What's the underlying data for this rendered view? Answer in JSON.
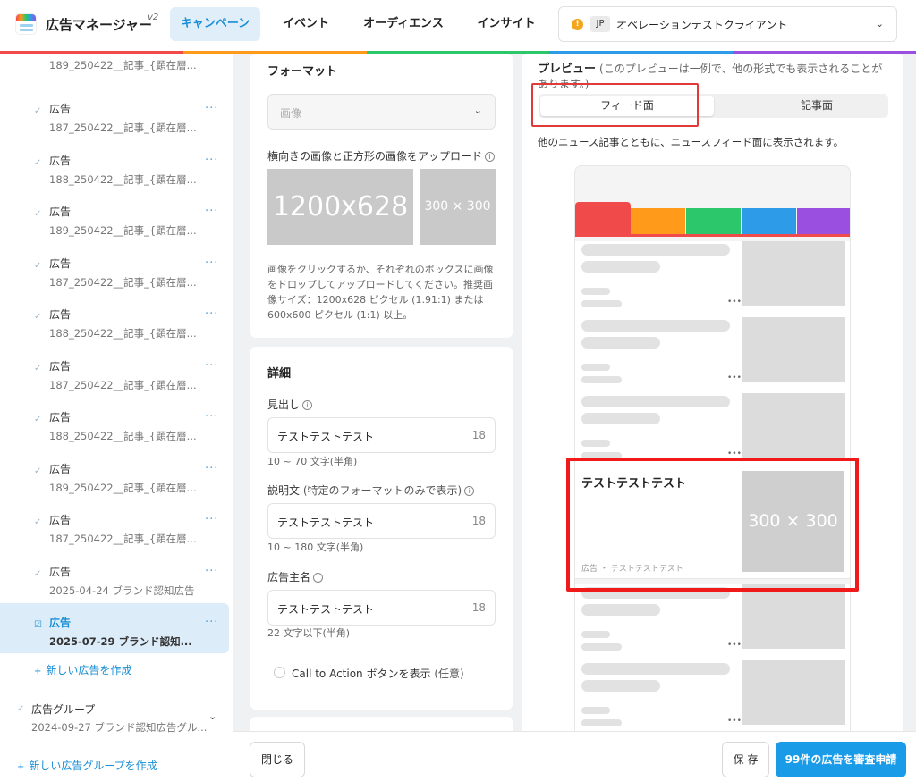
{
  "header": {
    "app_title": "広告マネージャー",
    "version": "v2",
    "tabs": [
      "キャンペーン",
      "イベント",
      "オーディエンス",
      "インサイト"
    ],
    "account_badge": "JP",
    "account_name": "オペレーションテストクライアント",
    "account_status_icon": "!"
  },
  "rainbow_colors": [
    "#f04a4a",
    "#ff9a1a",
    "#2cc66b",
    "#2d9be8",
    "#9b4fe0"
  ],
  "sidebar": {
    "partial_item_sub": "189_250422__記事_{顕在層...",
    "items": [
      {
        "title": "広告",
        "sub": "187_250422__記事_{顕在層..."
      },
      {
        "title": "広告",
        "sub": "188_250422__記事_{顕在層..."
      },
      {
        "title": "広告",
        "sub": "189_250422__記事_{顕在層..."
      },
      {
        "title": "広告",
        "sub": "187_250422__記事_{顕在層..."
      },
      {
        "title": "広告",
        "sub": "188_250422__記事_{顕在層..."
      },
      {
        "title": "広告",
        "sub": "187_250422__記事_{顕在層..."
      },
      {
        "title": "広告",
        "sub": "188_250422__記事_{顕在層..."
      },
      {
        "title": "広告",
        "sub": "189_250422__記事_{顕在層..."
      },
      {
        "title": "広告",
        "sub": "187_250422__記事_{顕在層..."
      },
      {
        "title": "広告",
        "sub": "2025-04-24 ブランド認知広告"
      },
      {
        "title": "広告",
        "sub": "2025-07-29 ブランド認知..."
      }
    ],
    "new_ad": "新しい広告を作成",
    "group": {
      "title": "広告グループ",
      "sub": "2024-09-27 ブランド認知広告グル..."
    },
    "new_group": "新しい広告グループを作成"
  },
  "format": {
    "title": "フォーマット",
    "select_value": "画像",
    "upload_label": "横向きの画像と正方形の画像をアップロード",
    "landscape": "1200x628",
    "square": "300 × 300",
    "help": "画像をクリックするか、それぞれのボックスに画像をドロップしてアップロードしてください。推奨画像サイズ：1200x628 ピクセル (1.91:1) または 600x600 ピクセル (1:1) 以上。"
  },
  "details": {
    "title": "詳細",
    "headline_label": "見出し",
    "headline_value": "テストテストテスト",
    "headline_count": "18",
    "headline_hint": "10 ~ 70 文字(半角)",
    "desc_label": "説明文",
    "desc_note": "(特定のフォーマットのみで表示)",
    "desc_value": "テストテストテスト",
    "desc_count": "18",
    "desc_hint": "10 ~ 180 文字(半角)",
    "advertiser_label": "広告主名",
    "advertiser_value": "テストテストテスト",
    "advertiser_count": "18",
    "advertiser_hint": "22 文字以下(半角)",
    "cta_label": "Call to Action ボタンを表示",
    "cta_note": "(任意)"
  },
  "preview": {
    "title": "プレビュー",
    "note": "(このプレビューは一例で、他の形式でも表示されることがあります。)",
    "tabs": [
      "フィード面",
      "記事面"
    ],
    "description": "他のニュース記事とともに、ニュースフィード面に表示されます。",
    "ad_title": "テストテストテスト",
    "ad_image": "300 × 300",
    "ad_meta": "広告 ・ テストテストテスト"
  },
  "footer": {
    "close": "閉じる",
    "save": "保 存",
    "submit": "99件の広告を審査申請"
  }
}
